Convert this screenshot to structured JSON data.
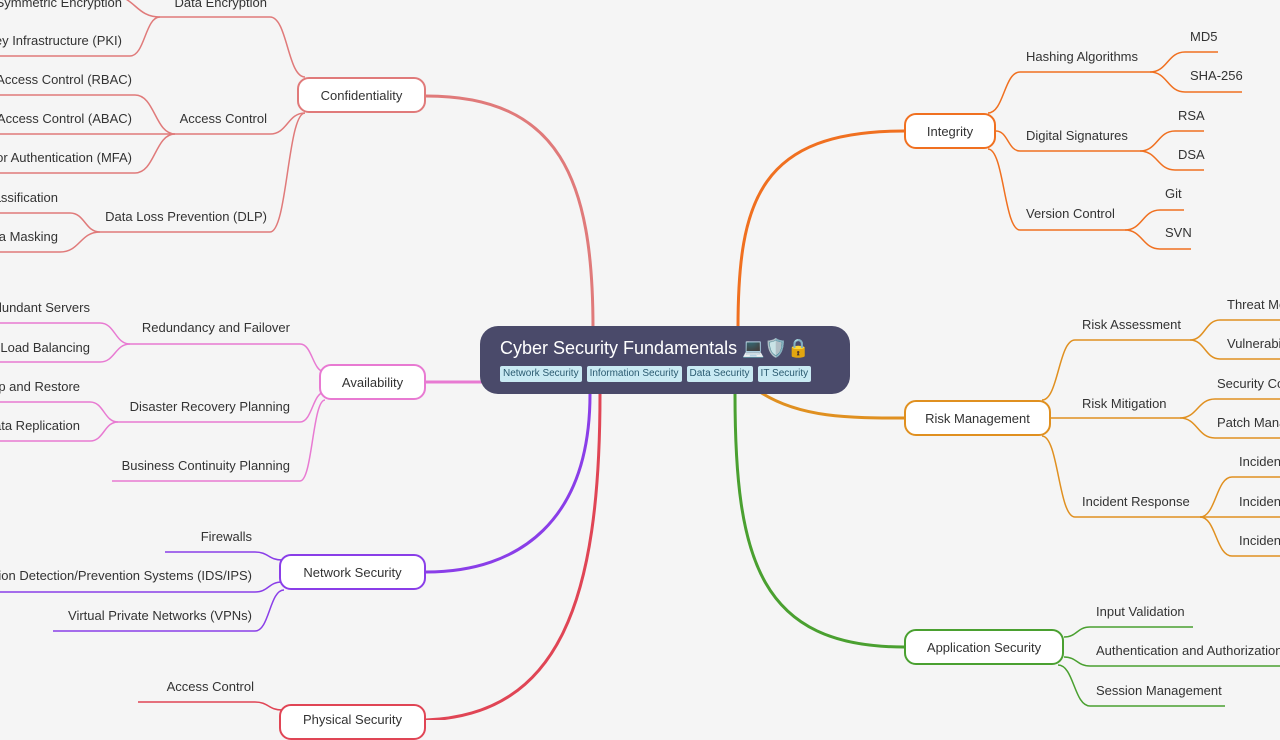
{
  "root": {
    "title": "Cyber Security Fundamentals",
    "emoji": "💻🛡️🔒",
    "tags": [
      "Network Security",
      "Information Security",
      "Data Security",
      "IT Security"
    ]
  },
  "branches": {
    "confidentiality": {
      "label": "Confidentiality",
      "color": "#e07a7a",
      "children": [
        {
          "label": "Data Encryption",
          "children": [
            "Symmetric Encryption",
            "Public Key Infrastructure (PKI)"
          ]
        },
        {
          "label": "Access Control",
          "children": [
            "Role-Based Access Control (RBAC)",
            "Attribute-Based Access Control (ABAC)",
            "Multi-Factor Authentication (MFA)"
          ]
        },
        {
          "label": "Data Loss Prevention (DLP)",
          "children": [
            "Data Classification",
            "Data Masking"
          ]
        }
      ]
    },
    "availability": {
      "label": "Availability",
      "color": "#e87ad2",
      "children": [
        {
          "label": "Redundancy and Failover",
          "children": [
            "Redundant Servers",
            "Load Balancing"
          ]
        },
        {
          "label": "Disaster Recovery Planning",
          "children": [
            "Backup and Restore",
            "Data Replication"
          ]
        },
        {
          "label": "Business Continuity Planning",
          "children": []
        }
      ]
    },
    "network": {
      "label": "Network Security",
      "color": "#8a3ee8",
      "children": [
        {
          "label": "Firewalls"
        },
        {
          "label": "Intrusion Detection/Prevention Systems (IDS/IPS)"
        },
        {
          "label": "Virtual Private Networks (VPNs)"
        }
      ]
    },
    "physical": {
      "label": "Physical Security",
      "color": "#e04555",
      "children": [
        {
          "label": "Access Control"
        }
      ]
    },
    "integrity": {
      "label": "Integrity",
      "color": "#f07020",
      "children": [
        {
          "label": "Hashing Algorithms",
          "children": [
            "MD5",
            "SHA-256"
          ]
        },
        {
          "label": "Digital Signatures",
          "children": [
            "RSA",
            "DSA"
          ]
        },
        {
          "label": "Version Control",
          "children": [
            "Git",
            "SVN"
          ]
        }
      ]
    },
    "risk": {
      "label": "Risk Management",
      "color": "#e09020",
      "children": [
        {
          "label": "Risk Assessment",
          "children": [
            "Threat Modeling",
            "Vulnerability Assessment"
          ]
        },
        {
          "label": "Risk Mitigation",
          "children": [
            "Security Controls",
            "Patch Management"
          ]
        },
        {
          "label": "Incident Response",
          "children": [
            "Incident Detection",
            "Incident Containment",
            "Incident Recovery"
          ]
        }
      ]
    },
    "appsec": {
      "label": "Application Security",
      "color": "#4aa030",
      "children": [
        {
          "label": "Input Validation"
        },
        {
          "label": "Authentication and Authorization"
        },
        {
          "label": "Session Management"
        }
      ]
    }
  }
}
